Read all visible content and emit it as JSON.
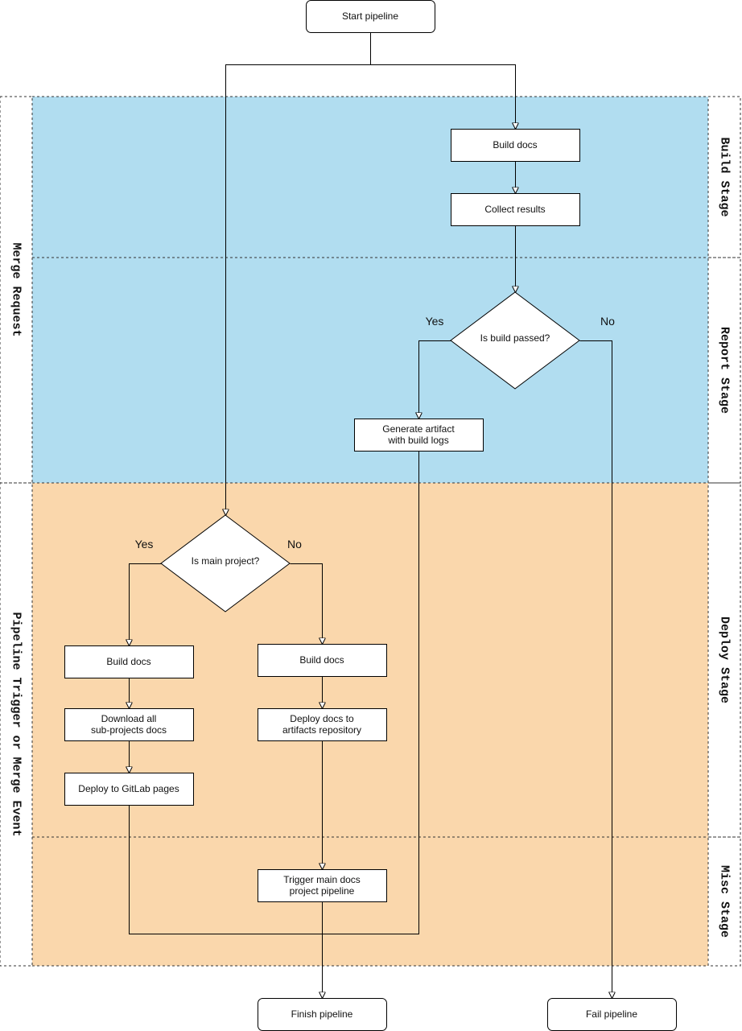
{
  "colors": {
    "report_build_band": "#b1ddf0",
    "deploy_misc_band": "#fad7ac",
    "lane_header": "#f5f5f5",
    "edge": "#000000"
  },
  "lanes_left": [
    {
      "id": "merge-request",
      "label": "Merge Request"
    },
    {
      "id": "pipeline-trigger",
      "label": "Pipeline Trigger or Merge Event"
    }
  ],
  "lanes_right": [
    {
      "id": "build-stage",
      "label": "Build Stage"
    },
    {
      "id": "report-stage",
      "label": "Report Stage"
    },
    {
      "id": "deploy-stage",
      "label": "Deploy Stage"
    },
    {
      "id": "misc-stage",
      "label": "Misc Stage"
    }
  ],
  "nodes": [
    {
      "id": "start",
      "shape": "terminal",
      "lines": [
        "Start pipeline"
      ]
    },
    {
      "id": "build-docs-1",
      "shape": "process",
      "lines": [
        "Build docs"
      ]
    },
    {
      "id": "collect-results",
      "shape": "process",
      "lines": [
        "Collect results"
      ]
    },
    {
      "id": "is-build-passed",
      "shape": "decision",
      "lines": [
        "Is build passed?"
      ]
    },
    {
      "id": "generate-artifact",
      "shape": "process",
      "lines": [
        "Generate artifact",
        "with build logs"
      ]
    },
    {
      "id": "is-main-project",
      "shape": "decision",
      "lines": [
        "Is main project?"
      ]
    },
    {
      "id": "build-docs-main",
      "shape": "process",
      "lines": [
        "Build docs"
      ]
    },
    {
      "id": "build-docs-sub",
      "shape": "process",
      "lines": [
        "Build docs"
      ]
    },
    {
      "id": "download-all",
      "shape": "process",
      "lines": [
        "Download all",
        "sub-projects docs"
      ]
    },
    {
      "id": "deploy-artifacts",
      "shape": "process",
      "lines": [
        "Deploy docs to",
        "artifacts repository"
      ]
    },
    {
      "id": "deploy-gitlab",
      "shape": "process",
      "lines": [
        "Deploy to GitLab pages"
      ]
    },
    {
      "id": "trigger-main",
      "shape": "process",
      "lines": [
        "Trigger main docs",
        "project pipeline"
      ]
    },
    {
      "id": "finish",
      "shape": "terminal",
      "lines": [
        "Finish pipeline"
      ]
    },
    {
      "id": "fail",
      "shape": "terminal",
      "lines": [
        "Fail pipeline"
      ]
    }
  ],
  "edges": [
    {
      "from": "start",
      "to": "is-main-project"
    },
    {
      "from": "start",
      "to": "build-docs-1"
    },
    {
      "from": "build-docs-1",
      "to": "collect-results"
    },
    {
      "from": "collect-results",
      "to": "is-build-passed"
    },
    {
      "from": "is-build-passed",
      "to": "generate-artifact",
      "label": "Yes"
    },
    {
      "from": "is-build-passed",
      "to": "fail",
      "label": "No"
    },
    {
      "from": "generate-artifact",
      "to": "deploy-gitlab"
    },
    {
      "from": "is-main-project",
      "to": "build-docs-main",
      "label": "Yes"
    },
    {
      "from": "is-main-project",
      "to": "build-docs-sub",
      "label": "No"
    },
    {
      "from": "build-docs-main",
      "to": "download-all"
    },
    {
      "from": "download-all",
      "to": "deploy-gitlab"
    },
    {
      "from": "build-docs-sub",
      "to": "deploy-artifacts"
    },
    {
      "from": "deploy-artifacts",
      "to": "trigger-main"
    },
    {
      "from": "trigger-main",
      "to": "finish"
    }
  ]
}
